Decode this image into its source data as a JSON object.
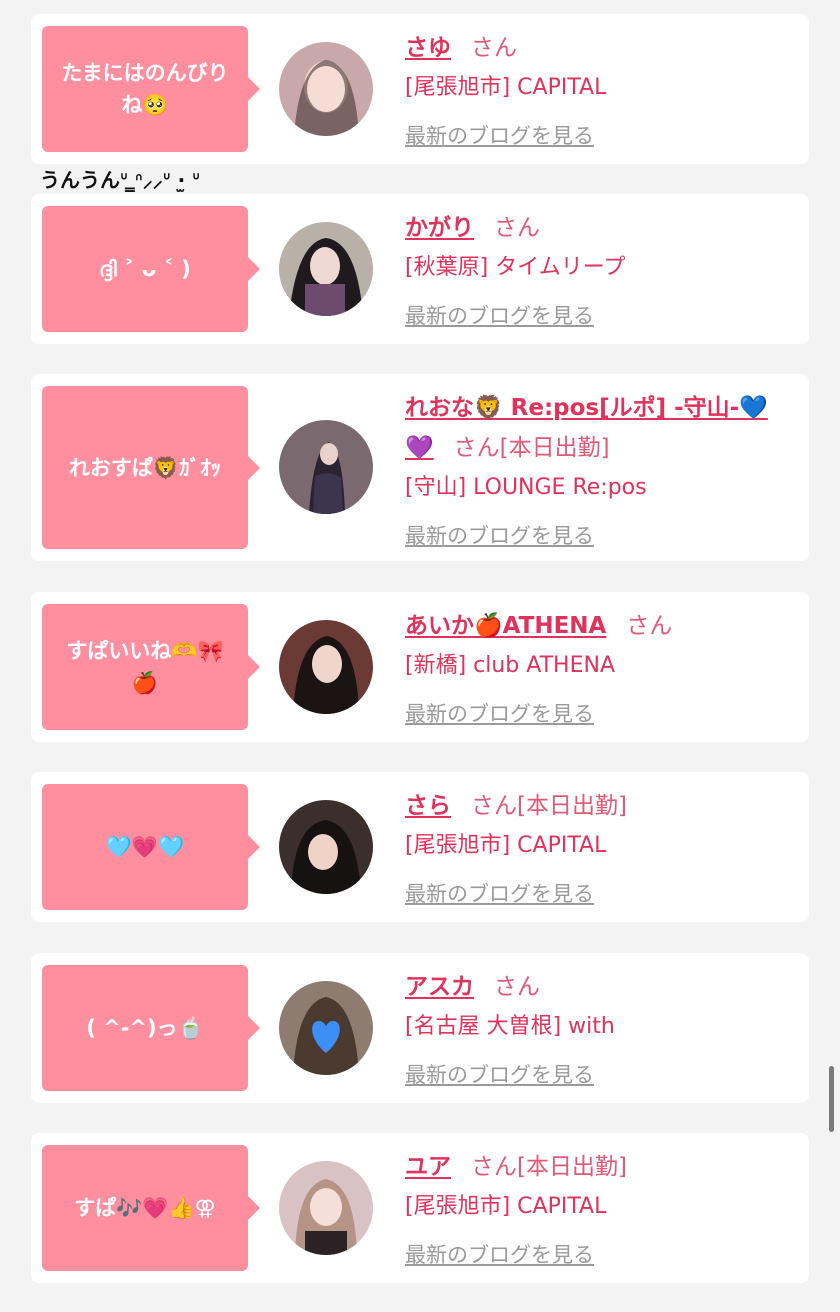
{
  "cards": [
    {
      "comment": "たまにはのんびりね🥺",
      "name": "さゆ",
      "honorific": "さん",
      "status": "",
      "shop": "[尾張旭市] CAPITAL",
      "blog_link": "最新のブログを見る",
      "avatar_color": "#c8a8a8"
    },
    {
      "comment": "ദ്ദി ˃ ᴗ ˂ )",
      "name": "かがり",
      "honorific": "さん",
      "status": "",
      "shop": "[秋葉原] タイムリープ",
      "blog_link": "最新のブログを見る",
      "avatar_color": "#6c4b6f"
    },
    {
      "comment": "れおすぱ🦁ｶﾞｵｯ",
      "name_line1": "れおな🦁 Re:pos[ルポ] -守山-💙",
      "name_line2": "💜",
      "honorific": "さん",
      "status": "[本日出勤]",
      "shop": "[守山] LOUNGE Re:pos",
      "blog_link": "最新のブログを見る",
      "avatar_color": "#5b4c5e"
    },
    {
      "comment": "すぱいいね🫶🎀🍎",
      "name": "あいか🍎ATHENA",
      "honorific": "さん",
      "status": "",
      "shop": "[新橋] club ATHENA",
      "blog_link": "最新のブログを見る",
      "avatar_color": "#6b3a34"
    },
    {
      "comment": "🩵💗🩵",
      "name": "さら",
      "honorific": "さん",
      "status": "[本日出勤]",
      "shop": "[尾張旭市] CAPITAL",
      "blog_link": "最新のブログを見る",
      "avatar_color": "#3b2f2c"
    },
    {
      "comment": "( ^-^)っ🍵",
      "name": "アスカ",
      "honorific": "さん",
      "status": "",
      "shop": "[名古屋 大曽根] with",
      "blog_link": "最新のブログを見る",
      "avatar_color": "#8e7c71"
    },
    {
      "comment": "すぱ🎶💗👍⚢",
      "name": "ユア",
      "honorific": "さん",
      "status": "[本日出勤]",
      "shop": "[尾張旭市] CAPITAL",
      "blog_link": "最新のブログを見る",
      "avatar_color": "#d8c2c4"
    }
  ],
  "extra_comment": "うんうんᐡ ̳ᐢ⸝⸝ᐡ ·̫ ᐡ",
  "colors": {
    "accent": "#e0325a",
    "bubble": "#ff8f9e",
    "background": "#f3f3f3"
  }
}
